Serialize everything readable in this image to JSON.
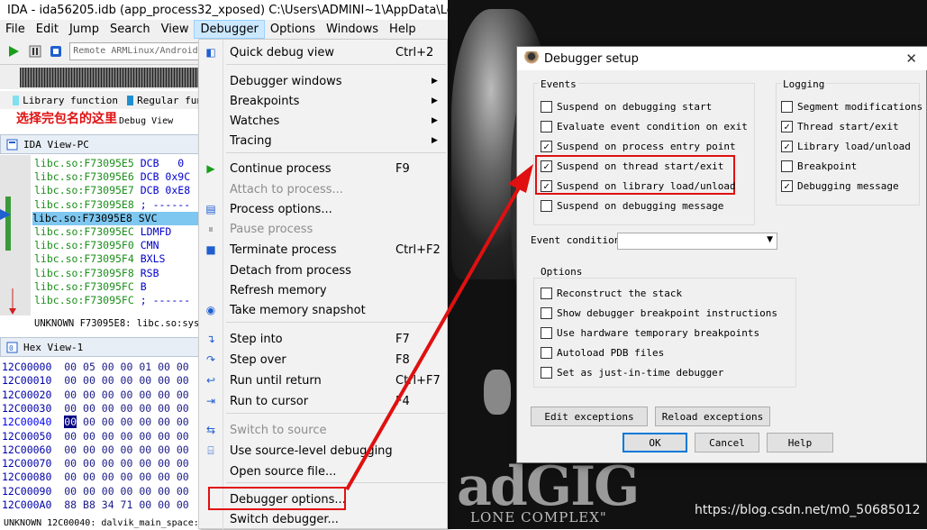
{
  "window": {
    "title": "IDA - ida56205.idb (app_process32_xposed) C:\\Users\\ADMINI~1\\AppData\\Local\\T"
  },
  "menubar": [
    "File",
    "Edit",
    "Jump",
    "Search",
    "View",
    "Debugger",
    "Options",
    "Windows",
    "Help"
  ],
  "toolbar": {
    "debugger_combo": "Remote ARMLinux/Android"
  },
  "legend": {
    "library_function": "Library function",
    "regular_function": "Regular fun",
    "library_color": "#7fe0f0",
    "regular_color": "#1f8fd0"
  },
  "annotation": "选择完包名的这里",
  "debug_view_label": "Debug View",
  "ida_view": {
    "title": "IDA View-PC",
    "rows": [
      {
        "addr": "libc.so:F73095E5",
        "ins": "DCB",
        "op": "   0"
      },
      {
        "addr": "libc.so:F73095E6",
        "ins": "DCB",
        "op": " 0x9C"
      },
      {
        "addr": "libc.so:F73095E7",
        "ins": "DCB",
        "op": " 0xE8"
      },
      {
        "addr": "libc.so:F73095E8",
        "ins": ";",
        "op": " ------"
      },
      {
        "addr": "libc.so:F73095E8",
        "ins": "SVC",
        "op": ""
      },
      {
        "addr": "libc.so:F73095EC",
        "ins": "LDMFD",
        "op": ""
      },
      {
        "addr": "libc.so:F73095F0",
        "ins": "CMN",
        "op": ""
      },
      {
        "addr": "libc.so:F73095F4",
        "ins": "BXLS",
        "op": ""
      },
      {
        "addr": "libc.so:F73095F8",
        "ins": "RSB",
        "op": ""
      },
      {
        "addr": "libc.so:F73095FC",
        "ins": "B",
        "op": ""
      },
      {
        "addr": "libc.so:F73095FC",
        "ins": ";",
        "op": " ------"
      }
    ],
    "status": "UNKNOWN F73095E8: libc.so:sysc"
  },
  "hex_view": {
    "title": "Hex View-1",
    "rows": [
      {
        "addr": "12C00000",
        "bytes": "00 05 00 00 01 00 00"
      },
      {
        "addr": "12C00010",
        "bytes": "00 00 00 00 00 00 00"
      },
      {
        "addr": "12C00020",
        "bytes": "00 00 00 00 00 00 00"
      },
      {
        "addr": "12C00030",
        "bytes": "00 00 00 00 00 00 00"
      },
      {
        "addr": "12C00040",
        "bytes": "00 00 00 00 00 00 00"
      },
      {
        "addr": "12C00050",
        "bytes": "00 00 00 00 00 00 00"
      },
      {
        "addr": "12C00060",
        "bytes": "00 00 00 00 00 00 00"
      },
      {
        "addr": "12C00070",
        "bytes": "00 00 00 00 00 00 00"
      },
      {
        "addr": "12C00080",
        "bytes": "00 00 00 00 00 00 00"
      },
      {
        "addr": "12C00090",
        "bytes": "00 00 00 00 00 00 00"
      },
      {
        "addr": "12C000A0",
        "bytes": "88 B8 34 71 00 00 00"
      }
    ],
    "status": "UNKNOWN 12C00040: dalvik_main_space:"
  },
  "debugger_menu": {
    "items": [
      {
        "label": "Quick debug view",
        "shortcut": "Ctrl+2",
        "icon": "quick-debug-icon"
      },
      {
        "label": "Debugger windows",
        "submenu": "▶"
      },
      {
        "label": "Breakpoints",
        "submenu": "▶"
      },
      {
        "label": "Watches",
        "submenu": "▶"
      },
      {
        "label": "Tracing",
        "submenu": "▶"
      },
      {
        "label": "Continue process",
        "shortcut": "F9",
        "icon": "play-icon"
      },
      {
        "label": "Attach to process...",
        "disabled": true
      },
      {
        "label": "Process options...",
        "icon": "process-options-icon"
      },
      {
        "label": "Pause process",
        "disabled": true,
        "icon": "pause-icon"
      },
      {
        "label": "Terminate process",
        "shortcut": "Ctrl+F2",
        "icon": "stop-icon"
      },
      {
        "label": "Detach from process"
      },
      {
        "label": "Refresh memory"
      },
      {
        "label": "Take memory snapshot",
        "icon": "snapshot-icon"
      },
      {
        "label": "Step into",
        "shortcut": "F7",
        "icon": "step-into-icon"
      },
      {
        "label": "Step over",
        "shortcut": "F8",
        "icon": "step-over-icon"
      },
      {
        "label": "Run until return",
        "shortcut": "Ctrl+F7",
        "icon": "run-return-icon"
      },
      {
        "label": "Run to cursor",
        "shortcut": "F4",
        "icon": "run-cursor-icon"
      },
      {
        "label": "Switch to source",
        "disabled": true,
        "icon": "switch-source-icon"
      },
      {
        "label": "Use source-level debugging",
        "icon": "source-debug-icon"
      },
      {
        "label": "Open source file..."
      },
      {
        "label": "Debugger options..."
      },
      {
        "label": "Switch debugger..."
      }
    ]
  },
  "background": {
    "logo": "adGIG",
    "subtitle": "LONE COMPLEX\"",
    "watermark": "https://blog.csdn.net/m0_50685012"
  },
  "dialog": {
    "title": "Debugger setup",
    "events_title": "Events",
    "events": [
      {
        "label": "Suspend on debugging start",
        "checked": false
      },
      {
        "label": "Evaluate event condition on exit",
        "checked": false
      },
      {
        "label": "Suspend on process entry point",
        "checked": true
      },
      {
        "label": "Suspend on thread start/exit",
        "checked": true
      },
      {
        "label": "Suspend on library load/unload",
        "checked": true
      },
      {
        "label": "Suspend on debugging message",
        "checked": false
      }
    ],
    "logging_title": "Logging",
    "logging": [
      {
        "label": "Segment modifications",
        "checked": false
      },
      {
        "label": "Thread start/exit",
        "checked": true
      },
      {
        "label": "Library load/unload",
        "checked": true
      },
      {
        "label": "Breakpoint",
        "checked": false
      },
      {
        "label": "Debugging message",
        "checked": true
      }
    ],
    "event_condition_label": "Event condition",
    "event_condition_value": "",
    "options_title": "Options",
    "options": [
      {
        "label": "Reconstruct the stack",
        "checked": false
      },
      {
        "label": "Show debugger breakpoint instructions",
        "checked": false
      },
      {
        "label": "Use hardware temporary breakpoints",
        "checked": false
      },
      {
        "label": "Autoload PDB files",
        "checked": false
      },
      {
        "label": "Set as just-in-time debugger",
        "checked": false
      }
    ],
    "buttons": {
      "edit_exceptions": "Edit exceptions",
      "reload_exceptions": "Reload exceptions",
      "ok": "OK",
      "cancel": "Cancel",
      "help": "Help"
    }
  }
}
